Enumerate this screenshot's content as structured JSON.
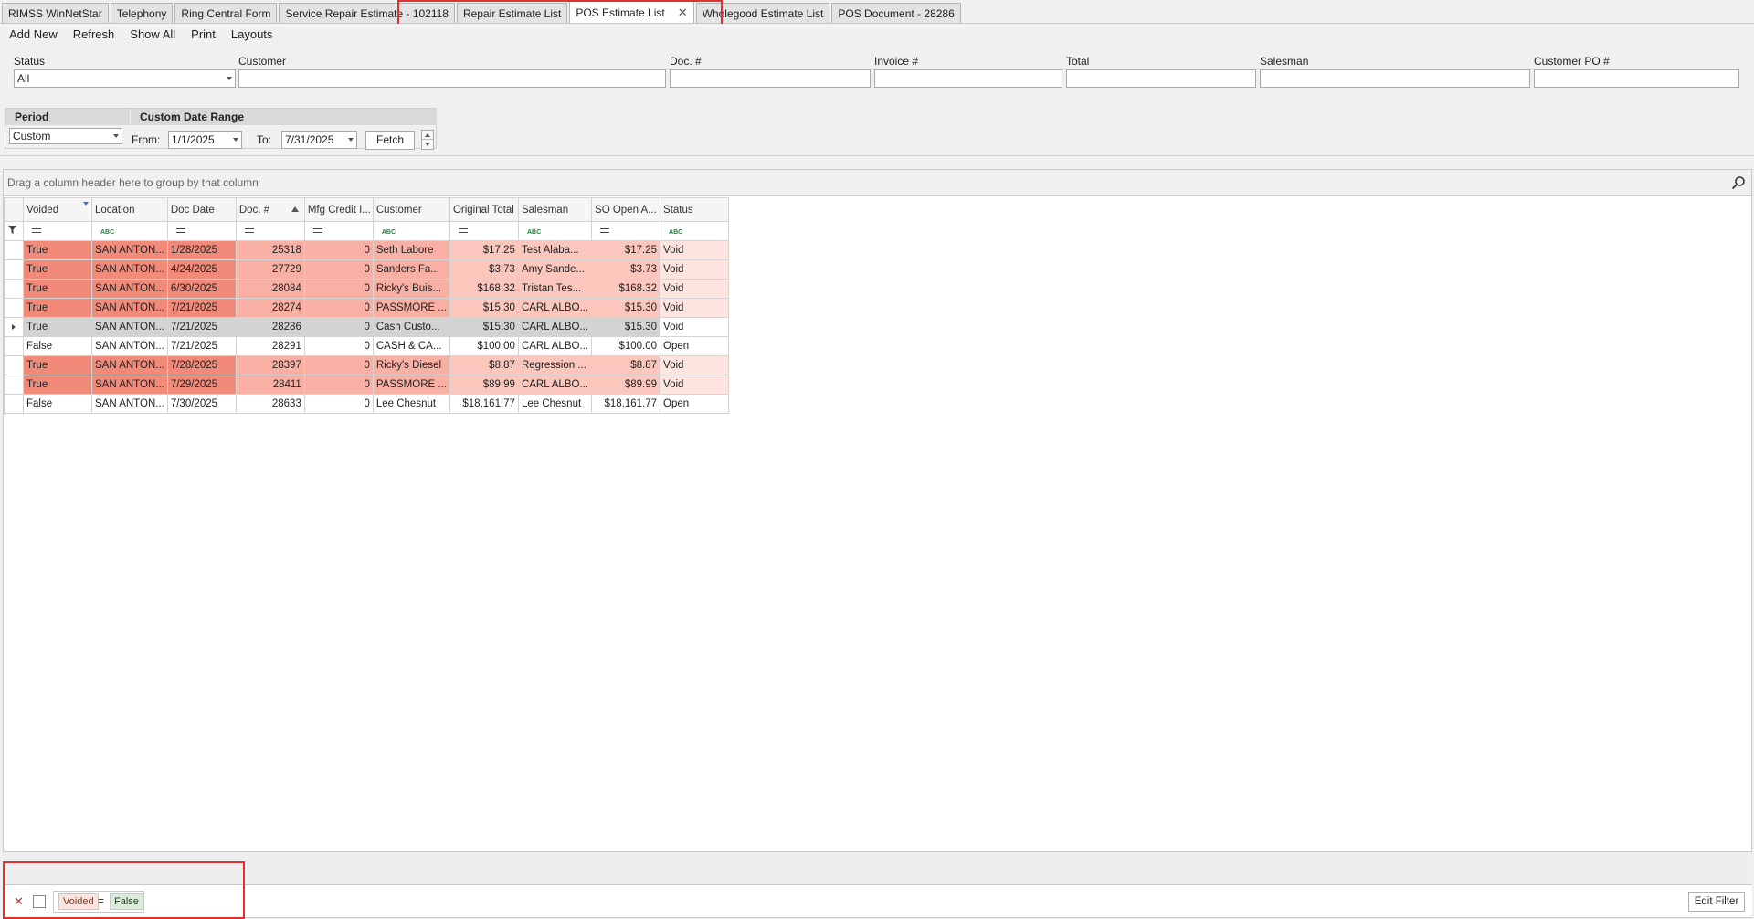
{
  "tabs": [
    {
      "label": "RIMSS WinNetStar"
    },
    {
      "label": "Telephony"
    },
    {
      "label": "Ring Central Form"
    },
    {
      "label": "Service Repair Estimate - 102118"
    },
    {
      "label": "Repair Estimate List"
    },
    {
      "label": "POS Estimate List",
      "active": true
    },
    {
      "label": "Wholegood Estimate List"
    },
    {
      "label": "POS Document - 28286"
    }
  ],
  "toolbar": {
    "add_new": "Add New",
    "refresh": "Refresh",
    "show_all": "Show All",
    "print": "Print",
    "layouts": "Layouts"
  },
  "filters": {
    "status_label": "Status",
    "status_value": "All",
    "customer_label": "Customer",
    "doc_label": "Doc. #",
    "invoice_label": "Invoice #",
    "total_label": "Total",
    "salesman_label": "Salesman",
    "customer_po_label": "Customer PO #"
  },
  "period": {
    "period_label": "Period",
    "period_value": "Custom",
    "range_label": "Custom Date Range",
    "from_label": "From:",
    "from_value": "1/1/2025",
    "to_label": "To:",
    "to_value": "7/31/2025",
    "fetch_label": "Fetch"
  },
  "grid": {
    "group_hint": "Drag a column header here to group by that column",
    "columns": [
      "Voided",
      "Location",
      "Doc Date",
      "Doc. #",
      "Mfg Credit I...",
      "Customer",
      "Original Total",
      "Salesman",
      "SO Open A...",
      "Status"
    ],
    "rows": [
      {
        "voided": "True",
        "location": "SAN ANTON...",
        "date": "1/28/2025",
        "doc": "25318",
        "mfg": "0",
        "customer": "Seth Labore",
        "total": "$17.25",
        "salesman": "Test  Alaba...",
        "open": "$17.25",
        "status": "Void"
      },
      {
        "voided": "True",
        "location": "SAN ANTON...",
        "date": "4/24/2025",
        "doc": "27729",
        "mfg": "0",
        "customer": "Sanders Fa...",
        "total": "$3.73",
        "salesman": "Amy  Sande...",
        "open": "$3.73",
        "status": "Void"
      },
      {
        "voided": "True",
        "location": "SAN ANTON...",
        "date": "6/30/2025",
        "doc": "28084",
        "mfg": "0",
        "customer": "Ricky's Buis...",
        "total": "$168.32",
        "salesman": "Tristan  Tes...",
        "open": "$168.32",
        "status": "Void"
      },
      {
        "voided": "True",
        "location": "SAN ANTON...",
        "date": "7/21/2025",
        "doc": "28274",
        "mfg": "0",
        "customer": "PASSMORE ...",
        "total": "$15.30",
        "salesman": "CARL  ALBO...",
        "open": "$15.30",
        "status": "Void"
      },
      {
        "voided": "True",
        "location": "SAN ANTON...",
        "date": "7/21/2025",
        "doc": "28286",
        "mfg": "0",
        "customer": "Cash Custo...",
        "total": "$15.30",
        "salesman": "CARL  ALBO...",
        "open": "$15.30",
        "status": "Void"
      },
      {
        "voided": "False",
        "location": "SAN ANTON...",
        "date": "7/21/2025",
        "doc": "28291",
        "mfg": "0",
        "customer": "CASH & CA...",
        "total": "$100.00",
        "salesman": "CARL  ALBO...",
        "open": "$100.00",
        "status": "Open"
      },
      {
        "voided": "True",
        "location": "SAN ANTON...",
        "date": "7/28/2025",
        "doc": "28397",
        "mfg": "0",
        "customer": "Ricky's Diesel",
        "total": "$8.87",
        "salesman": "Regression ...",
        "open": "$8.87",
        "status": "Void"
      },
      {
        "voided": "True",
        "location": "SAN ANTON...",
        "date": "7/29/2025",
        "doc": "28411",
        "mfg": "0",
        "customer": "PASSMORE ...",
        "total": "$89.99",
        "salesman": "CARL  ALBO...",
        "open": "$89.99",
        "status": "Void"
      },
      {
        "voided": "False",
        "location": "SAN ANTON...",
        "date": "7/30/2025",
        "doc": "28633",
        "mfg": "0",
        "customer": "Lee Chesnut",
        "total": "$18,161.77",
        "salesman": "Lee  Chesnut",
        "open": "$18,161.77",
        "status": "Open"
      }
    ]
  },
  "filter_bar": {
    "field": "Voided",
    "operator": "=",
    "value": "False",
    "edit_label": "Edit Filter"
  },
  "colors": {
    "void_dark": "#f28a7a",
    "void_mid": "#f8b0a4",
    "void_light": "#fde4de",
    "selected": "#d3d3d3",
    "highlight": "#e03030"
  }
}
